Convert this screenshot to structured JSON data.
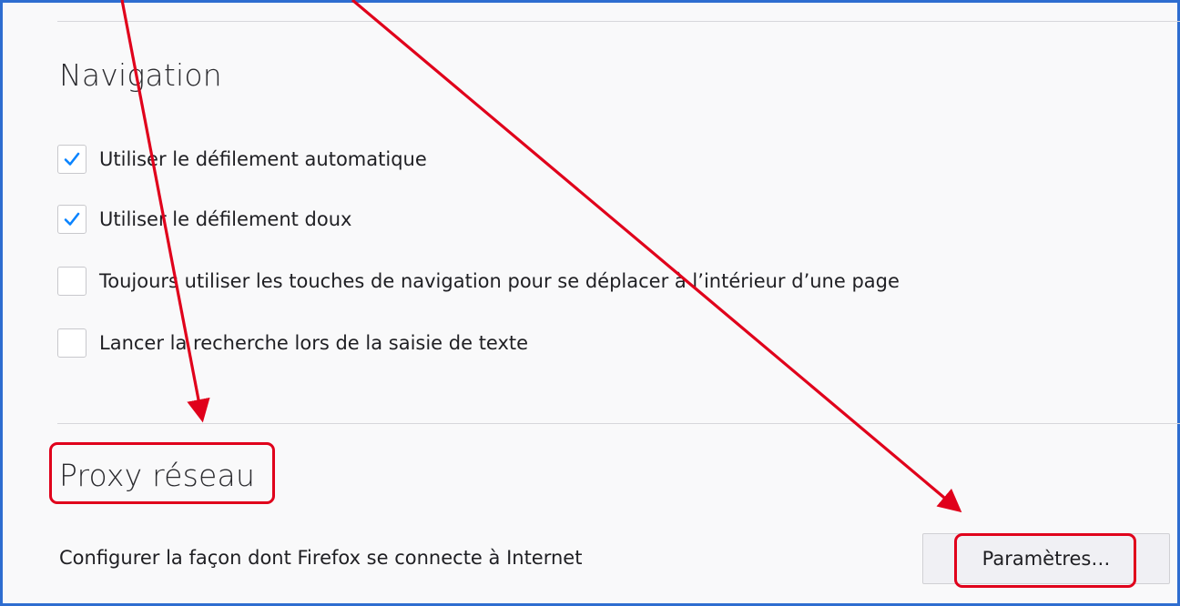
{
  "navigation": {
    "heading": "Navigation",
    "options": [
      {
        "label": "Utiliser le défilement automatique",
        "checked": true
      },
      {
        "label": "Utiliser le défilement doux",
        "checked": true
      },
      {
        "label": "Toujours utiliser les touches de navigation pour se déplacer à l’intérieur d’une page",
        "checked": false
      },
      {
        "label": "Lancer la recherche lors de la saisie de texte",
        "checked": false
      }
    ]
  },
  "proxy": {
    "heading": "Proxy réseau",
    "description": "Configurer la façon dont Firefox se connecte à Internet",
    "settings_button": "Paramètres…"
  },
  "colors": {
    "frame_border": "#2e6dd0",
    "checkmark": "#0a84ff",
    "annotation": "#e0001b"
  },
  "icons": {
    "checkbox_checked": "checkmark-icon"
  }
}
